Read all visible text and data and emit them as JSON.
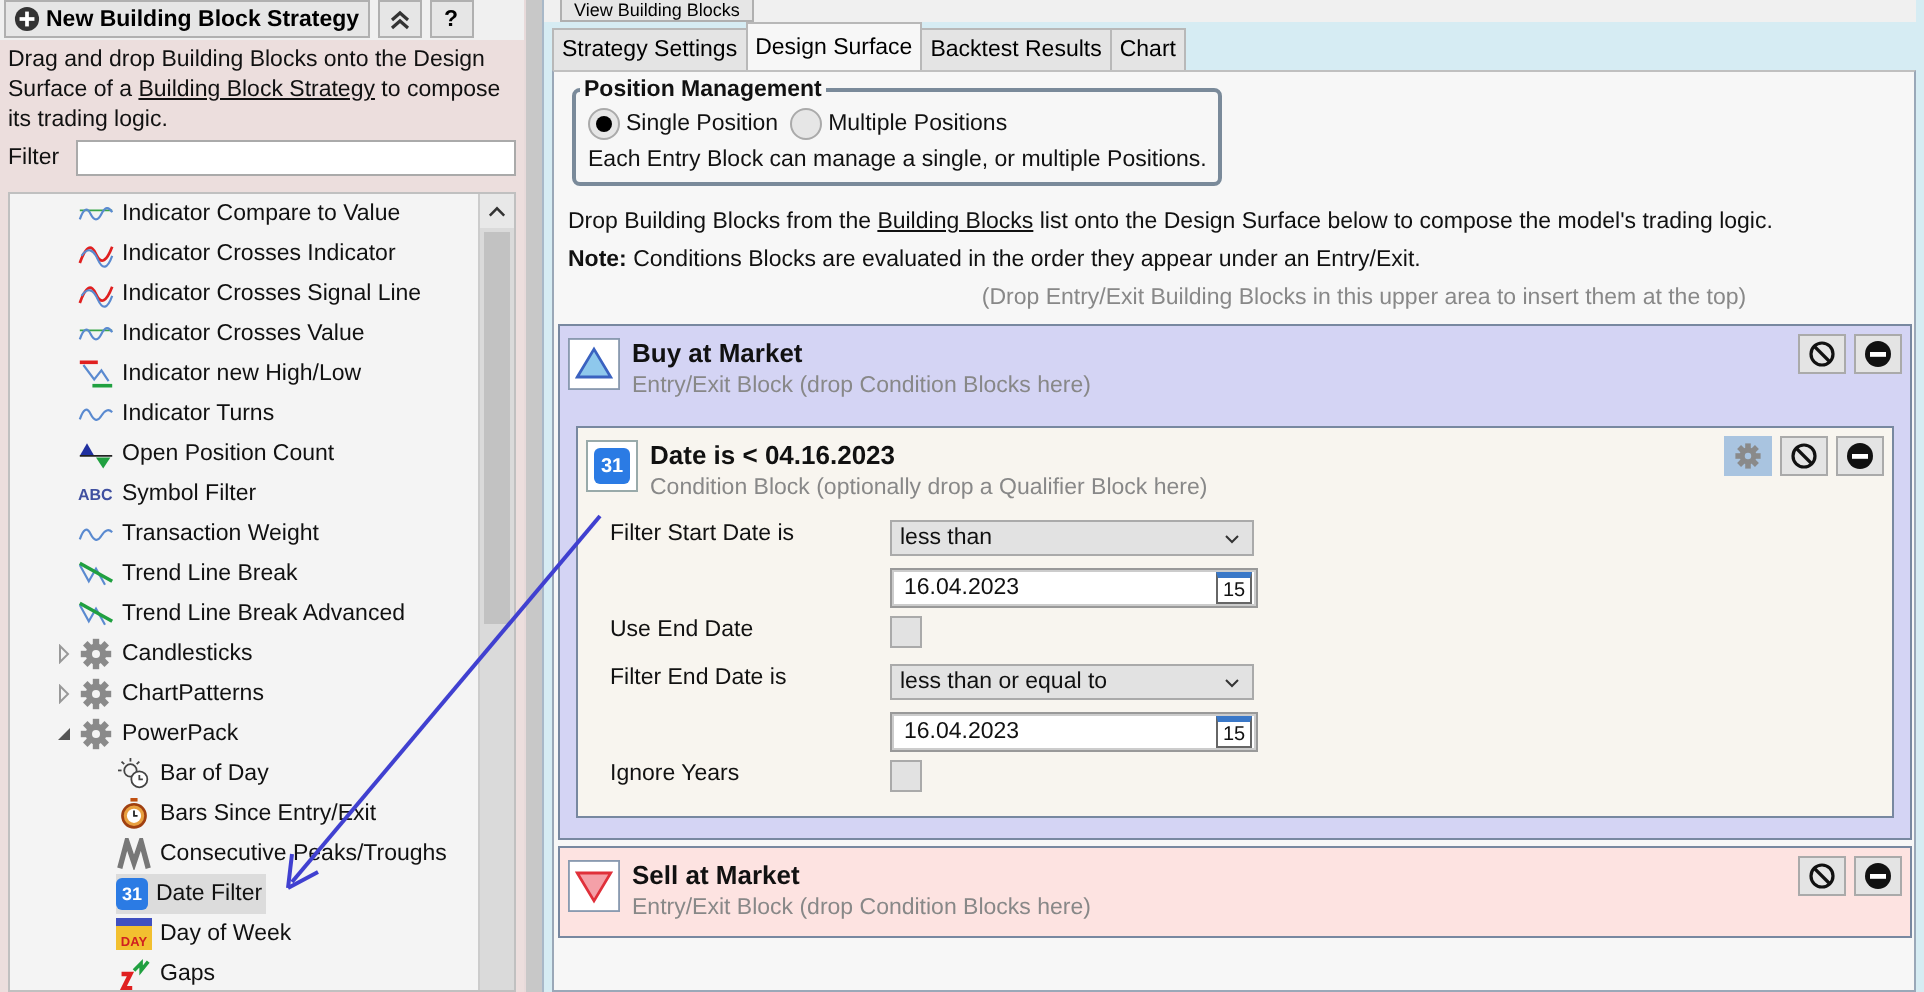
{
  "toolbar": {
    "new_button": "New Building Block Strategy",
    "help_button": "?"
  },
  "description": {
    "before": "Drag and drop Building Blocks onto the Design Surface of a ",
    "link": "Building Block Strategy",
    "after": " to compose its trading logic."
  },
  "filter": {
    "label": "Filter"
  },
  "tree": {
    "items": [
      {
        "label": "Indicator Compare to Value",
        "kind": "wave-line",
        "selected": false
      },
      {
        "label": "Indicator Crosses Indicator",
        "kind": "cross",
        "selected": false
      },
      {
        "label": "Indicator Crosses Signal Line",
        "kind": "cross",
        "selected": false
      },
      {
        "label": "Indicator Crosses Value",
        "kind": "wave-line",
        "selected": false
      },
      {
        "label": "Indicator new High/Low",
        "kind": "high-low",
        "selected": false
      },
      {
        "label": "Indicator Turns",
        "kind": "wave",
        "selected": false
      },
      {
        "label": "Open Position Count",
        "kind": "triangles",
        "selected": false
      },
      {
        "label": "Symbol Filter",
        "kind": "text",
        "icon_text": "ABC",
        "selected": false
      },
      {
        "label": "Transaction Weight",
        "kind": "wave",
        "selected": false
      },
      {
        "label": "Trend Line Break",
        "kind": "trend",
        "selected": false
      },
      {
        "label": "Trend Line Break Advanced",
        "kind": "trend",
        "selected": false
      },
      {
        "label": "Candlesticks",
        "kind": "gear",
        "selected": false,
        "expanded": false
      },
      {
        "label": "ChartPatterns",
        "kind": "gear",
        "selected": false,
        "expanded": false
      },
      {
        "label": "PowerPack",
        "kind": "gear",
        "selected": false,
        "expanded": true,
        "children": [
          {
            "label": "Bar of Day",
            "kind": "sun-clock",
            "selected": false
          },
          {
            "label": "Bars Since Entry/Exit",
            "kind": "stopwatch",
            "selected": false
          },
          {
            "label": "Consecutive Peaks/Troughs",
            "kind": "peaks",
            "selected": false
          },
          {
            "label": "Date Filter",
            "kind": "calendar",
            "icon_text": "31",
            "selected": true
          },
          {
            "label": "Day of Week",
            "kind": "day",
            "icon_text": "DAY",
            "selected": false
          },
          {
            "label": "Gaps",
            "kind": "gaps",
            "selected": false
          }
        ]
      }
    ]
  },
  "right": {
    "view_button": "View Building Blocks",
    "tabs": [
      {
        "label": "Strategy Settings",
        "selected": false
      },
      {
        "label": "Design Surface",
        "selected": true
      },
      {
        "label": "Backtest Results",
        "selected": false
      },
      {
        "label": "Chart",
        "selected": false
      }
    ],
    "position_management": {
      "title": "Position Management",
      "options": [
        {
          "label": "Single Position",
          "selected": true
        },
        {
          "label": "Multiple Positions",
          "selected": false
        }
      ],
      "note": "Each Entry Block can manage a single, or multiple Positions."
    },
    "instructions": {
      "before": "Drop Building Blocks from the ",
      "link": "Building Blocks",
      "after": " list onto the Design Surface below to compose the model's trading logic."
    },
    "note": {
      "label": "Note:",
      "text": " Conditions Blocks are evaluated in the order they appear under an Entry/Exit."
    },
    "drop_hint": "(Drop Entry/Exit Building Blocks in this upper area to insert them at the top)",
    "blocks": [
      {
        "kind": "entry",
        "title": "Buy at Market",
        "subtitle": "Entry/Exit Block (drop Condition Blocks here)",
        "conditions": [
          {
            "title": "Date is < 04.16.2023",
            "subtitle": "Condition Block (optionally drop a Qualifier Block here)",
            "icon_text": "31",
            "settings_active": true,
            "fields": [
              {
                "kind": "select",
                "label": "Filter Start Date is",
                "value": "less than"
              },
              {
                "kind": "date",
                "value": "16.04.2023",
                "picker_text": "15"
              },
              {
                "kind": "checkbox",
                "label": "Use End Date",
                "checked": false
              },
              {
                "kind": "select",
                "label": "Filter End Date is",
                "value": "less than or equal to"
              },
              {
                "kind": "date",
                "value": "16.04.2023",
                "picker_text": "15"
              },
              {
                "kind": "checkbox",
                "label": "Ignore Years",
                "checked": false
              }
            ]
          }
        ]
      },
      {
        "kind": "exit",
        "title": "Sell at Market",
        "subtitle": "Entry/Exit Block (drop Condition Blocks here)"
      }
    ]
  }
}
